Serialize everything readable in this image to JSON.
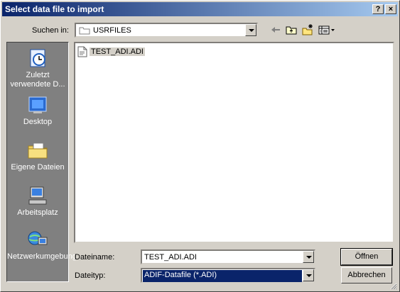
{
  "window": {
    "title": "Select data file to import",
    "help_label": "?",
    "close_label": "×"
  },
  "toolbar": {
    "lookin_label": "Suchen in:",
    "lookin_value": "USRFILES"
  },
  "places": [
    {
      "label": "Zuletzt verwendete D...",
      "icon": "recent-icon"
    },
    {
      "label": "Desktop",
      "icon": "desktop-icon"
    },
    {
      "label": "Eigene Dateien",
      "icon": "my-documents-icon"
    },
    {
      "label": "Arbeitsplatz",
      "icon": "my-computer-icon"
    },
    {
      "label": "Netzwerkumgebung",
      "icon": "network-icon"
    }
  ],
  "files": [
    {
      "name": "TEST_ADI.ADI"
    }
  ],
  "form": {
    "filename_label": "Dateiname:",
    "filename_value": "TEST_ADI.ADI",
    "filetype_label": "Dateityp:",
    "filetype_value": "ADIF-Datafile (*.ADI)"
  },
  "buttons": {
    "open": "Öffnen",
    "cancel": "Abbrechen"
  },
  "colors": {
    "title_start": "#0a246a",
    "title_end": "#a6caf0",
    "face": "#d4d0c8",
    "places_bg": "#808080",
    "selection": "#0a246a"
  }
}
